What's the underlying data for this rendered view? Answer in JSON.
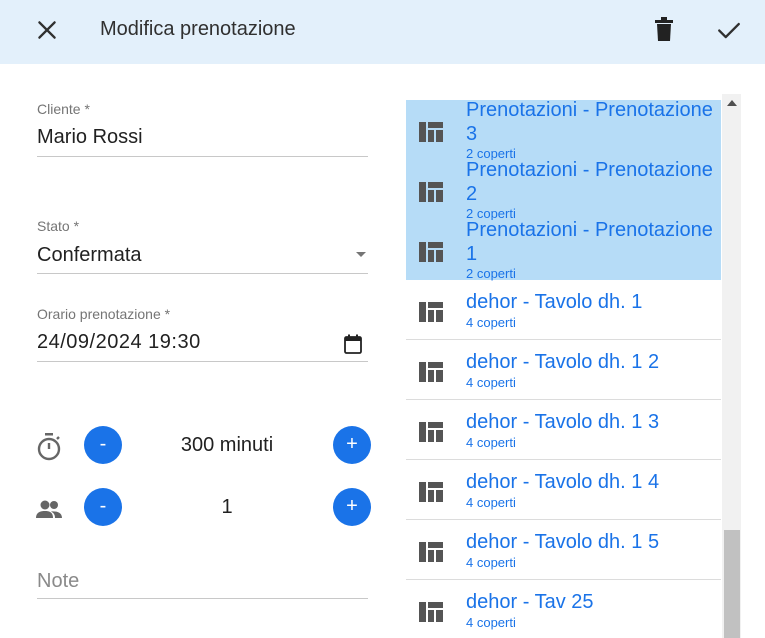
{
  "header": {
    "title": "Modifica prenotazione",
    "close_icon": "close-icon",
    "delete_icon": "trash-icon",
    "confirm_icon": "check-icon",
    "background": "#e3f0fb"
  },
  "form": {
    "cliente": {
      "label": "Cliente *",
      "value": "Mario Rossi"
    },
    "stato": {
      "label": "Stato *",
      "value": "Confermata"
    },
    "orario": {
      "label": "Orario prenotazione *",
      "value": "24/09/2024 19:30"
    },
    "durata": {
      "icon": "timer-icon",
      "minus": "-",
      "plus": "+",
      "value": "300 minuti"
    },
    "persone": {
      "icon": "people-icon",
      "minus": "-",
      "plus": "+",
      "value": "1"
    },
    "note": {
      "placeholder": "Note"
    }
  },
  "tables": {
    "accent": "#1a73e8",
    "selected_background": "#b6dcf7",
    "items": [
      {
        "name": "Prenotazioni - Prenotazione 3",
        "caption": "2 coperti",
        "selected": true
      },
      {
        "name": "Prenotazioni - Prenotazione 2",
        "caption": "2 coperti",
        "selected": true
      },
      {
        "name": "Prenotazioni - Prenotazione 1",
        "caption": "2 coperti",
        "selected": true
      },
      {
        "name": "dehor - Tavolo dh. 1",
        "caption": "4 coperti",
        "selected": false
      },
      {
        "name": "dehor - Tavolo dh. 1 2",
        "caption": "4 coperti",
        "selected": false
      },
      {
        "name": "dehor - Tavolo dh. 1 3",
        "caption": "4 coperti",
        "selected": false
      },
      {
        "name": "dehor - Tavolo dh. 1 4",
        "caption": "4 coperti",
        "selected": false
      },
      {
        "name": "dehor - Tavolo dh. 1 5",
        "caption": "4 coperti",
        "selected": false
      },
      {
        "name": "dehor - Tav 25",
        "caption": "4 coperti",
        "selected": false
      }
    ]
  }
}
